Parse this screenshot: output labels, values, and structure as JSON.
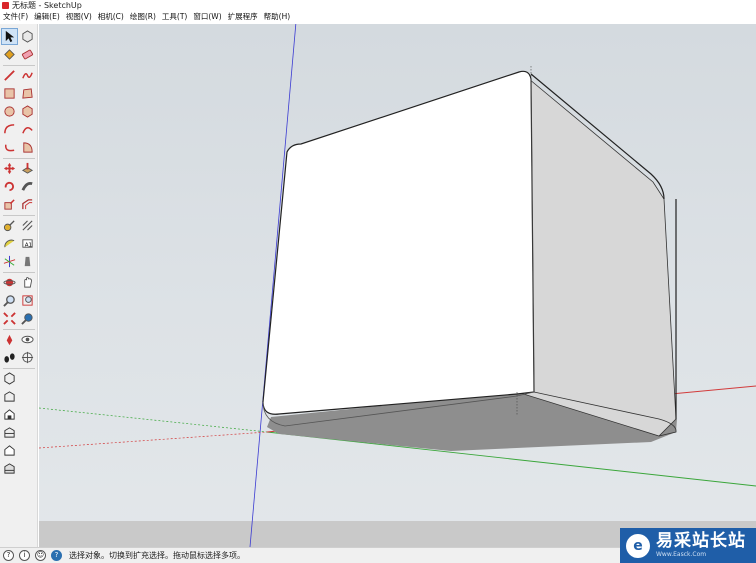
{
  "window": {
    "title": "无标题 - SketchUp"
  },
  "menu": [
    "文件(F)",
    "编辑(E)",
    "视图(V)",
    "相机(C)",
    "绘图(R)",
    "工具(T)",
    "窗口(W)",
    "扩展程序",
    "帮助(H)"
  ],
  "toolbar": {
    "tools": [
      [
        "select-icon",
        "component-icon"
      ],
      [
        "paint-bucket-icon",
        "eraser-icon"
      ],
      [
        "line-icon",
        "freehand-icon"
      ],
      [
        "rectangle-icon",
        "rotated-rectangle-icon"
      ],
      [
        "circle-icon",
        "polygon-icon"
      ],
      [
        "arc-icon",
        "two-point-arc-icon"
      ],
      [
        "three-point-arc-icon",
        "pie-icon"
      ],
      [
        "move-icon",
        "push-pull-icon"
      ],
      [
        "rotate-icon",
        "follow-me-icon"
      ],
      [
        "scale-icon",
        "offset-icon"
      ],
      [
        "tape-measure-icon",
        "dimension-icon"
      ],
      [
        "protractor-icon",
        "text-icon"
      ],
      [
        "axes-icon",
        "3d-text-icon"
      ],
      [
        "orbit-icon",
        "pan-icon"
      ],
      [
        "zoom-icon",
        "zoom-window-icon"
      ],
      [
        "zoom-extents-icon",
        "previous-view-icon"
      ],
      [
        "position-camera-icon",
        "look-around-icon"
      ],
      [
        "walk-icon",
        "section-plane-icon"
      ],
      [
        "iso-view-icon"
      ],
      [
        "top-view-icon"
      ],
      [
        "front-view-icon"
      ],
      [
        "right-view-icon"
      ],
      [
        "back-view-icon"
      ],
      [
        "left-view-icon"
      ]
    ],
    "active_tool": "select-icon"
  },
  "status": {
    "icons": [
      "geo-location-icon",
      "credits-icon",
      "user-icon",
      "help-icon"
    ],
    "text": "选择对象。切换到扩充选择。拖动鼠标选择多项。"
  },
  "colors": {
    "accent_red_axis": "#d23b3b",
    "accent_green_axis": "#3aa63a",
    "accent_blue_axis": "#3b3bd2",
    "watermark_bg": "#1f5ea8"
  },
  "watermark": {
    "cn": "易采站长站",
    "url": "Www.Easck.Com"
  }
}
